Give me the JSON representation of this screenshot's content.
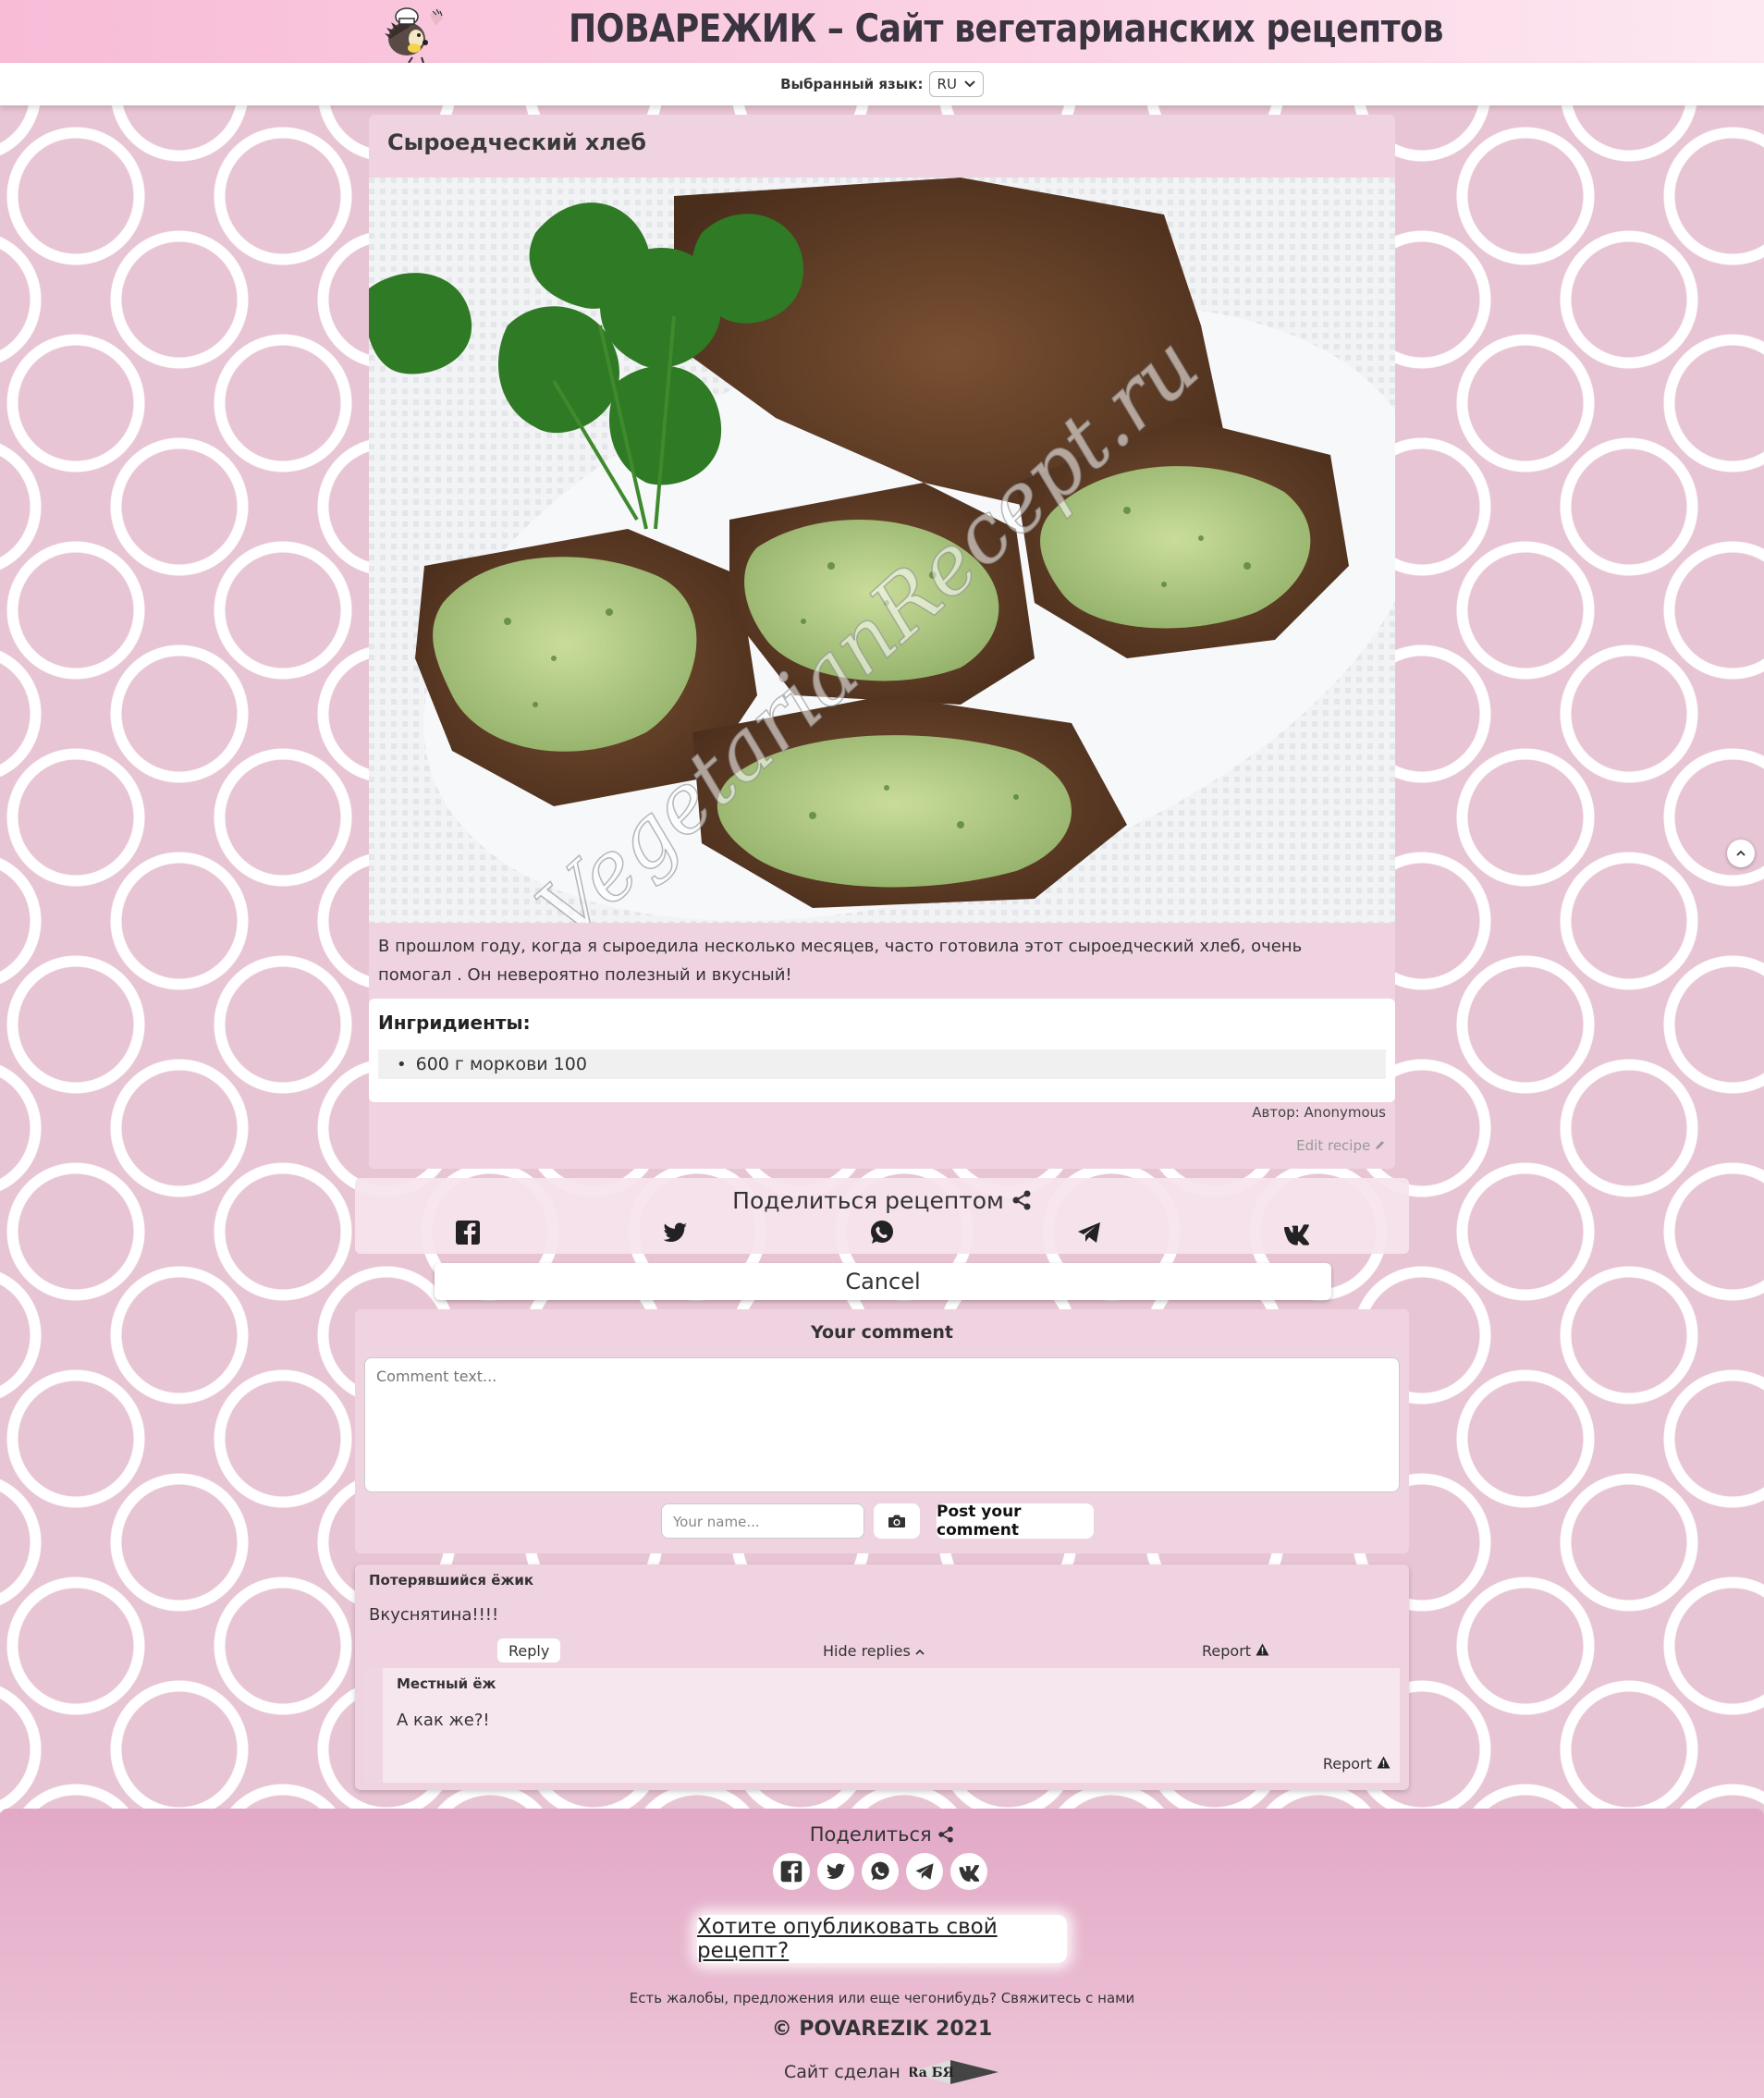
{
  "header": {
    "site_title": "ПОВАРЕЖИК – Сайт вегетарианских рецептов",
    "language_label": "Выбранный язык:",
    "language_value": "RU"
  },
  "recipe": {
    "title": "Сыроедческий хлеб",
    "photo_watermark": "VegetarianRecept.ru",
    "description": "В прошлом году, когда я сыроедила несколько месяцев, часто готовила этот сыроедческий хлеб, очень помогал .  Он невероятно полезный и вкусный!",
    "ingredients_heading": "Ингридиенты:",
    "ingredients": [
      "600 г моркови 100"
    ],
    "author": "Автор: Anonymous",
    "edit_label": "Edit recipe"
  },
  "share": {
    "title": "Поделиться рецептом",
    "icons": [
      "facebook-icon",
      "twitter-icon",
      "whatsapp-icon",
      "telegram-icon",
      "vk-icon"
    ],
    "cancel_label": "Cancel"
  },
  "comment_form": {
    "heading": "Your comment",
    "text_placeholder": "Comment text...",
    "name_placeholder": "Your name...",
    "post_label": "Post your comment"
  },
  "comments": [
    {
      "author": "Потерявшийся ёжик",
      "text": "Вкуснятина!!!!",
      "reply_label": "Reply",
      "hide_replies_label": "Hide replies",
      "report_label": "Report",
      "replies": [
        {
          "author": "Местный ёж",
          "text": "А как же?!",
          "report_label": "Report"
        }
      ]
    }
  ],
  "footer": {
    "share_label": "Поделиться",
    "publish_label": "Хотите опубликовать свой рецепт?",
    "contact_text": "Есть жалобы, предложения или еще чегонибудь? Свяжитесь с нами",
    "copyright": "© POVAREZIK 2021",
    "made_by": "Сайт сделан",
    "made_by_logo": "Ra БЯ"
  },
  "colors": {
    "card_pink": "#f0d3e1",
    "header_pink": "#f8bcd7",
    "footer_pink": "#e2a9c6"
  }
}
